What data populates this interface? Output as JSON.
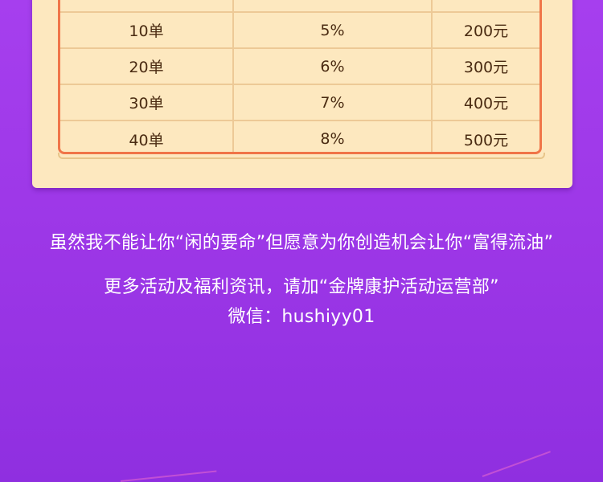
{
  "colors": {
    "background": "#9f3ae8",
    "card": "#fde8bf",
    "table_border": "#f07548",
    "cell_divider": "#edc996",
    "cell_text": "#4a2b12",
    "footer_text": "#ffffff"
  },
  "reward_table": {
    "rows": [
      {
        "orders": "10单",
        "rate": "5%",
        "bonus": "200元"
      },
      {
        "orders": "20单",
        "rate": "6%",
        "bonus": "300元"
      },
      {
        "orders": "30单",
        "rate": "7%",
        "bonus": "400元"
      },
      {
        "orders": "40单",
        "rate": "8%",
        "bonus": "500元"
      }
    ]
  },
  "footer": {
    "slogan": "虽然我不能让你“闲的要命”但愿意为你创造机会让你“富得流油”",
    "more_info": "更多活动及福利资讯，请加“金牌康护活动运营部”",
    "wechat": "微信：hushiyy01"
  }
}
